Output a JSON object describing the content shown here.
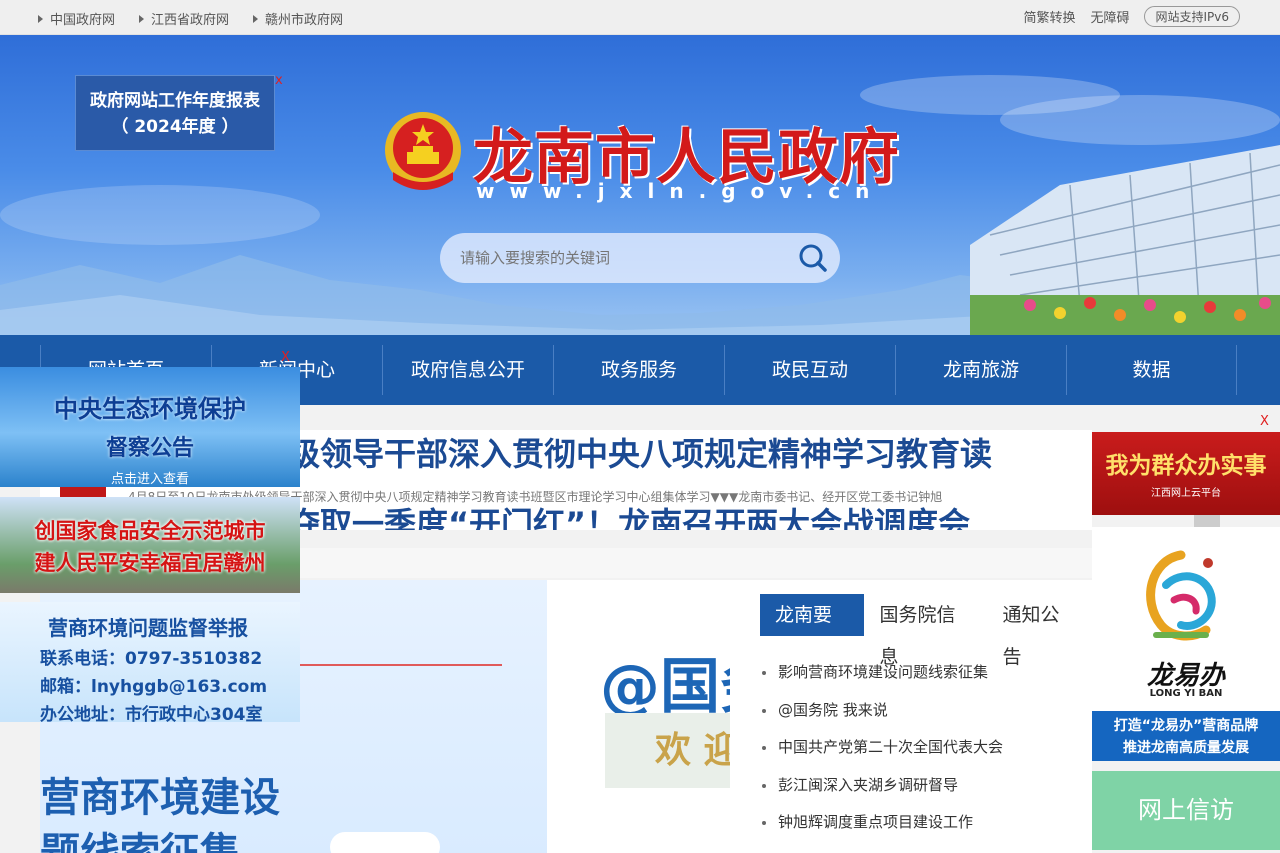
{
  "topbar": {
    "links": [
      "中国政府网",
      "江西省政府网",
      "赣州市政府网"
    ],
    "right": {
      "convert": "简繁转换",
      "accessible": "无障碍",
      "ipv6": "网站支持IPv6"
    }
  },
  "banner": {
    "report_line1": "政府网站工作年度报表",
    "report_line2": "（ 2024年度 ）",
    "close": "x",
    "title": "龙南市人民政府",
    "url": "www.jxln.gov.cn",
    "search_placeholder": "请输入要搜索的关键词"
  },
  "nav": {
    "items": [
      "网站首页",
      "新闻中心",
      "政府信息公开",
      "政务服务",
      "政民互动",
      "龙南旅游",
      "数据"
    ]
  },
  "headline": {
    "top": "级领导干部深入贯彻中央八项规定精神学习教育读",
    "sub": "4月8日至10日龙南市处级领导干部深入贯彻中央八项规定精神学习教育读书班暨区市理论学习中心组集体学习▼▼▼龙南市委书记、经开区党工委书记钟旭",
    "bottom": "夺取一季度“开门红”！龙南召开两大会战调度会"
  },
  "promo": {
    "at_text": "@国务",
    "welcome": "欢 迎",
    "title1": "营商环境建设",
    "title2": "题线索征集"
  },
  "news": {
    "tabs": [
      "龙南要闻",
      "国务院信息",
      "通知公告"
    ],
    "items": [
      "影响营商环境建设问题线索征集",
      "@国务院 我来说",
      "中国共产党第二十次全国代表大会",
      "彭江闽深入夹湖乡调研督导",
      "钟旭辉调度重点项目建设工作"
    ]
  },
  "left_ads": {
    "ad1": {
      "line1": "中央生态环境保护",
      "line2": "督察公告",
      "line3": "点击进入查看"
    },
    "ad2": {
      "line1": "创国家食品安全示范城市",
      "line2": "建人民平安幸福宜居赣州"
    },
    "ad3": {
      "title": "营商环境问题监督举报",
      "phone": "联系电话：0797-3510382",
      "email": "邮箱：lnyhggb@163.com",
      "address": "办公地址：市行政中心304室"
    }
  },
  "right_ads": {
    "close": "X",
    "ad1": {
      "line1": "我为群众办实事",
      "line2": "江西网上云平台"
    },
    "ad2": {
      "brand": "龙易办",
      "brand_en": "LONG YI BAN",
      "slogan1": "打造“龙易办”营商品牌",
      "slogan2": "推进龙南高质量发展"
    },
    "ad3": {
      "label": "网上信访"
    }
  }
}
